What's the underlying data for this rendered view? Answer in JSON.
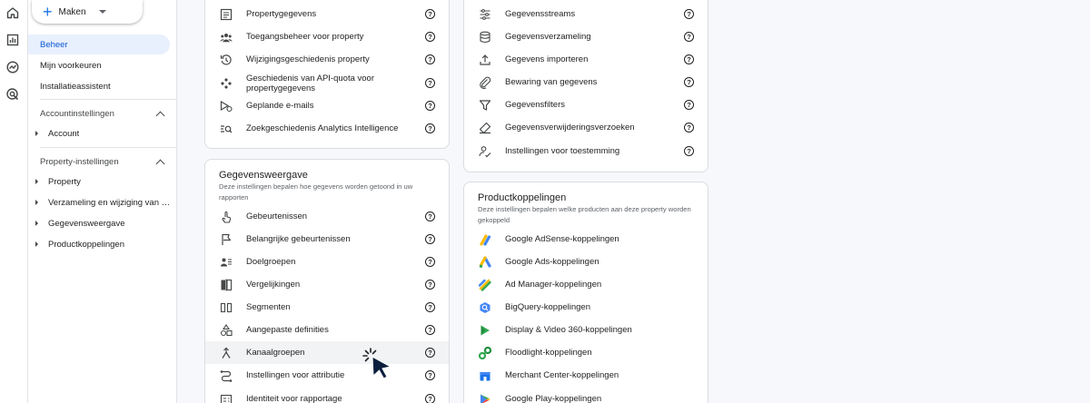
{
  "rail": {
    "icons": [
      "home-icon",
      "reports-icon",
      "explore-icon",
      "advertising-icon"
    ]
  },
  "nav": {
    "create_label": "Maken",
    "items": [
      {
        "label": "Beheer",
        "active": true
      },
      {
        "label": "Mijn voorkeuren"
      },
      {
        "label": "Installatieassistent"
      }
    ],
    "account_section": {
      "title": "Accountinstellingen",
      "items": [
        "Account"
      ]
    },
    "property_section": {
      "title": "Property-instellingen",
      "items": [
        "Property",
        "Verzameling en wijziging van gegevens",
        "Gegevensweergave",
        "Productkoppelingen"
      ]
    }
  },
  "property_card": {
    "rows": [
      {
        "label": "Propertygegevens",
        "icon": "property-details-icon"
      },
      {
        "label": "Toegangsbeheer voor property",
        "icon": "access-management-icon"
      },
      {
        "label": "Wijzigingsgeschiedenis property",
        "icon": "change-history-icon"
      },
      {
        "label": "Geschiedenis van API-quota voor propertygegevens",
        "icon": "api-quota-icon"
      },
      {
        "label": "Geplande e-mails",
        "icon": "scheduled-emails-icon"
      },
      {
        "label": "Zoekgeschiedenis Analytics Intelligence",
        "icon": "search-history-icon"
      }
    ]
  },
  "data_card": {
    "rows": [
      {
        "label": "Gegevensstreams",
        "icon": "data-streams-icon"
      },
      {
        "label": "Gegevensverzameling",
        "icon": "data-collection-icon"
      },
      {
        "label": "Gegevens importeren",
        "icon": "data-import-icon"
      },
      {
        "label": "Bewaring van gegevens",
        "icon": "data-retention-icon"
      },
      {
        "label": "Gegevensfilters",
        "icon": "data-filters-icon"
      },
      {
        "label": "Gegevensverwijderingsverzoeken",
        "icon": "data-deletion-icon"
      },
      {
        "label": "Instellingen voor toestemming",
        "icon": "consent-settings-icon"
      }
    ]
  },
  "display_card": {
    "title": "Gegevensweergave",
    "description": "Deze instellingen bepalen hoe gegevens worden getoond in uw rapporten",
    "rows": [
      {
        "label": "Gebeurtenissen",
        "icon": "events-icon"
      },
      {
        "label": "Belangrijke gebeurtenissen",
        "icon": "key-events-flag-icon"
      },
      {
        "label": "Doelgroepen",
        "icon": "audiences-icon"
      },
      {
        "label": "Vergelijkingen",
        "icon": "comparisons-icon"
      },
      {
        "label": "Segmenten",
        "icon": "segments-icon"
      },
      {
        "label": "Aangepaste definities",
        "icon": "custom-definitions-icon"
      },
      {
        "label": "Kanaalgroepen",
        "icon": "channel-groups-icon"
      },
      {
        "label": "Instellingen voor attributie",
        "icon": "attribution-icon"
      },
      {
        "label": "Identiteit voor rapportage",
        "icon": "reporting-identity-icon"
      }
    ]
  },
  "links_card": {
    "title": "Productkoppelingen",
    "description": "Deze instellingen bepalen welke producten aan deze property worden gekoppeld",
    "rows": [
      {
        "label": "Google AdSense-koppelingen",
        "icon": "adsense-icon"
      },
      {
        "label": "Google Ads-koppelingen",
        "icon": "google-ads-icon"
      },
      {
        "label": "Ad Manager-koppelingen",
        "icon": "ad-manager-icon"
      },
      {
        "label": "BigQuery-koppelingen",
        "icon": "bigquery-icon"
      },
      {
        "label": "Display & Video 360-koppelingen",
        "icon": "dv360-icon"
      },
      {
        "label": "Floodlight-koppelingen",
        "icon": "floodlight-icon"
      },
      {
        "label": "Merchant Center-koppelingen",
        "icon": "merchant-center-icon"
      },
      {
        "label": "Google Play-koppelingen",
        "icon": "google-play-icon"
      }
    ]
  },
  "help_glyph": "?",
  "colors": {
    "accent": "#1a73e8",
    "active_bg": "#e8f0fe",
    "active_text": "#0b57d0",
    "hover_bg": "#f1f3f4"
  }
}
